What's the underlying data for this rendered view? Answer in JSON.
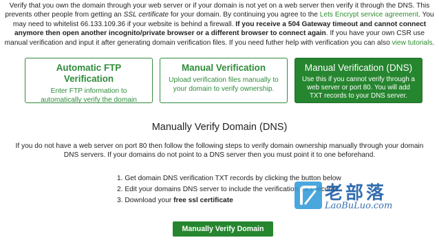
{
  "intro": {
    "t1": "Verify that you own the domain through your web server or if your domain is not yet on a web server then verify it through the DNS. This prevents other people from getting an ",
    "t1_em": "SSL certificate",
    "t2": " for your domain. By continuing you agree to the ",
    "link_agreement": "Lets Encrypt service agreement",
    "t3": ". You may need to whitelist 66.133.109.36 if your website is behind a firewall. ",
    "bold": "If you receive a 504 Gateway timeout and cannot connect anymore then open another incognito/private browser or a different browser to connect again",
    "t4": ". If you have your own CSR use manual verification and input it after generating domain verification files. If you need futher help with verification you can also ",
    "link_tutorials": "view tutorials",
    "t5": "."
  },
  "cards": [
    {
      "title": "Automatic FTP Verification",
      "desc": "Enter FTP information to automatically verify the domain"
    },
    {
      "title": "Manual Verification",
      "desc": "Upload verification files manually to your domain to verify ownership."
    },
    {
      "title": "Manual Verification (DNS)",
      "desc": "Use this if you cannot verify through a web server or port 80. You will add TXT records to your DNS server."
    }
  ],
  "heading": "Manually Verify Domain (DNS)",
  "paragraph": "If you do not have a web server on port 80 then follow the following steps to verify domain ownership manually through your domain DNS servers. If your domains do not point to a DNS server then you must point it to one beforehand.",
  "steps": {
    "s1": "1. Get domain DNS verification TXT records by clicking the button below",
    "s2": "2. Edit your domains DNS server to include the verification TXT records",
    "s3_prefix": "3. Download your ",
    "s3_bold": "free ssl certificate"
  },
  "button_label": "Manually Verify Domain",
  "watermark": {
    "cn": "老部落",
    "en": "LaoBuLuo.com"
  },
  "colors": {
    "accent": "#26852f",
    "link": "#2e8b2e",
    "watermark": "#1f5fa8"
  }
}
